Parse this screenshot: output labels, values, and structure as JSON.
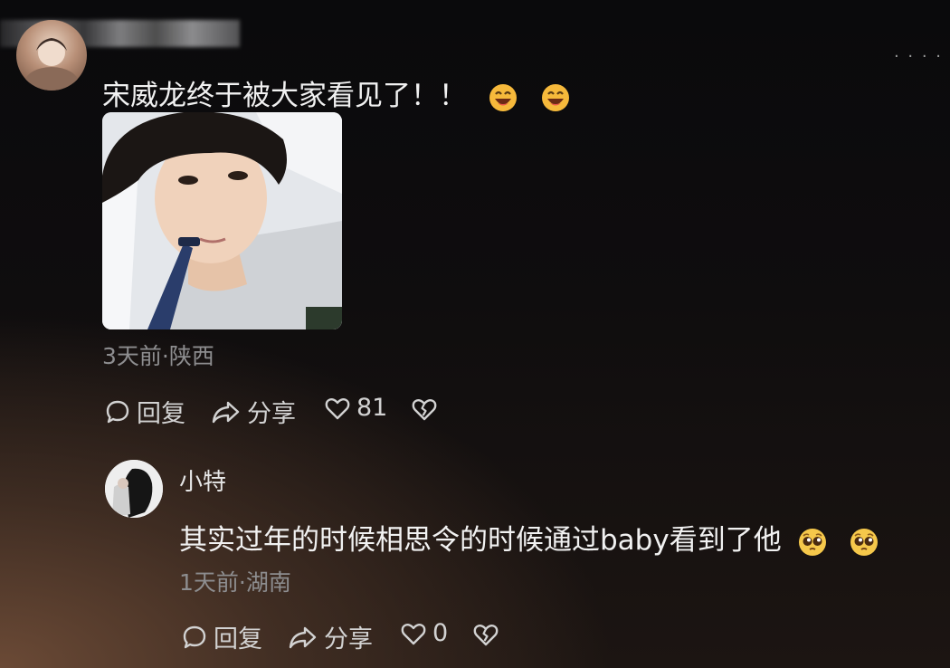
{
  "comment": {
    "avatar_icon": "user-avatar",
    "text": "宋威龙终于被大家看见了！！",
    "emojis": [
      "grinning-face",
      "grinning-face"
    ],
    "meta": "3天前·陕西",
    "actions": {
      "reply": "回复",
      "share": "分享",
      "likes": "81"
    }
  },
  "reply": {
    "avatar_icon": "user-avatar",
    "username": "小特",
    "text": "其实过年的时候相思令的时候通过baby看到了他",
    "emojis": [
      "pleading-face",
      "pleading-face"
    ],
    "meta": "1天前·湖南",
    "actions": {
      "reply": "回复",
      "share": "分享",
      "likes": "0"
    }
  },
  "colors": {
    "background": "#0f0d0e",
    "text": "#f1f1f1",
    "meta": "#8d8d8f",
    "emoji": "#f6b93b"
  }
}
